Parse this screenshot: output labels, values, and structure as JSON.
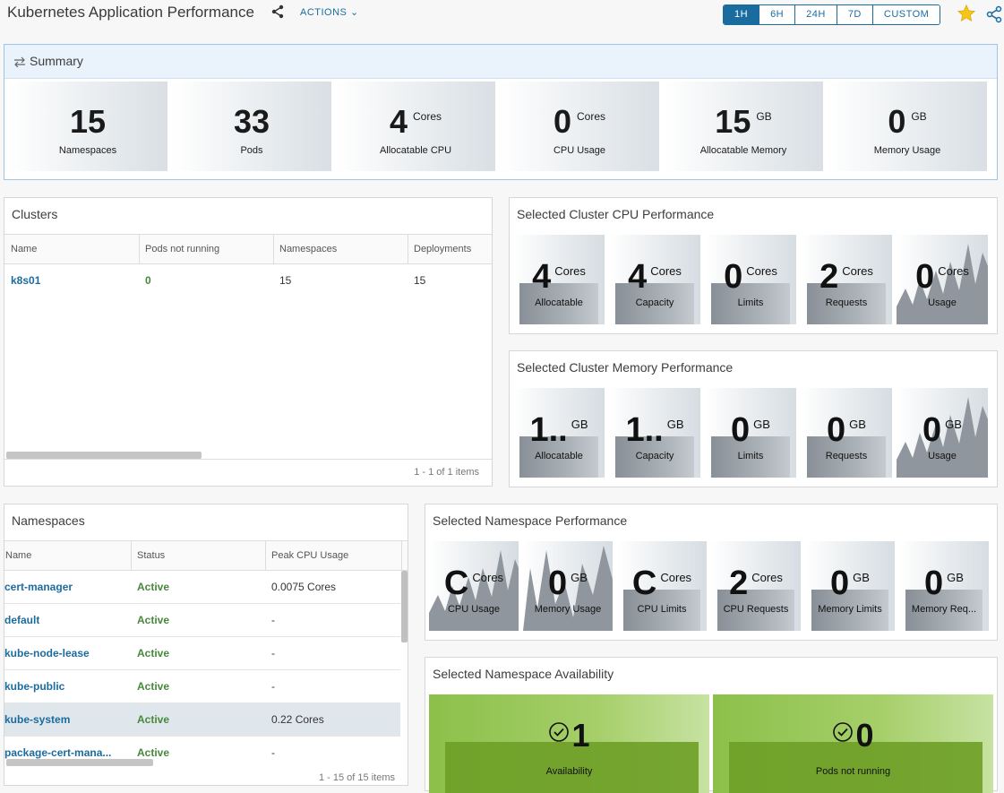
{
  "header": {
    "title": "Kubernetes Application Performance",
    "actions_label": "ACTIONS",
    "time_ranges": [
      "1H",
      "6H",
      "24H",
      "7D",
      "CUSTOM"
    ],
    "active_range": "1H"
  },
  "summary": {
    "title": "Summary",
    "tiles": [
      {
        "value": "15",
        "unit": "",
        "label": "Namespaces"
      },
      {
        "value": "33",
        "unit": "",
        "label": "Pods"
      },
      {
        "value": "4",
        "unit": "Cores",
        "label": "Allocatable CPU"
      },
      {
        "value": "0",
        "unit": "Cores",
        "label": "CPU Usage"
      },
      {
        "value": "15",
        "unit": "GB",
        "label": "Allocatable Memory"
      },
      {
        "value": "0",
        "unit": "GB",
        "label": "Memory Usage"
      }
    ]
  },
  "clusters": {
    "title": "Clusters",
    "columns": [
      "Name",
      "Pods not running",
      "Namespaces",
      "Deployments"
    ],
    "rows": [
      {
        "name": "k8s01",
        "pods_not_running": "0",
        "namespaces": "15",
        "deployments": "15"
      }
    ],
    "footer": "1 - 1 of 1 items"
  },
  "cluster_cpu": {
    "title": "Selected Cluster CPU Performance",
    "tiles": [
      {
        "value": "4",
        "unit": "Cores",
        "label": "Allocatable",
        "fill": 0.46
      },
      {
        "value": "4",
        "unit": "Cores",
        "label": "Capacity",
        "fill": 0.46
      },
      {
        "value": "0",
        "unit": "Cores",
        "label": "Limits",
        "fill": 0.46
      },
      {
        "value": "2",
        "unit": "Cores",
        "label": "Requests",
        "fill": 0.46
      },
      {
        "value": "0",
        "unit": "Cores",
        "label": "Usage",
        "fill": 0
      }
    ]
  },
  "cluster_mem": {
    "title": "Selected Cluster Memory Performance",
    "tiles": [
      {
        "value": "1..",
        "unit": "GB",
        "label": "Allocatable",
        "fill": 0.46
      },
      {
        "value": "1..",
        "unit": "GB",
        "label": "Capacity",
        "fill": 0.46
      },
      {
        "value": "0",
        "unit": "GB",
        "label": "Limits",
        "fill": 0.46
      },
      {
        "value": "0",
        "unit": "GB",
        "label": "Requests",
        "fill": 0.46
      },
      {
        "value": "0",
        "unit": "GB",
        "label": "Usage",
        "fill": 0
      }
    ]
  },
  "namespaces": {
    "title": "Namespaces",
    "columns": [
      "Name",
      "Status",
      "Peak CPU Usage"
    ],
    "rows": [
      {
        "name": "cert-manager",
        "status": "Active",
        "peak_cpu": "0.0075 Cores"
      },
      {
        "name": "default",
        "status": "Active",
        "peak_cpu": "-"
      },
      {
        "name": "kube-node-lease",
        "status": "Active",
        "peak_cpu": "-"
      },
      {
        "name": "kube-public",
        "status": "Active",
        "peak_cpu": "-"
      },
      {
        "name": "kube-system",
        "status": "Active",
        "peak_cpu": "0.22 Cores"
      },
      {
        "name": "package-cert-mana...",
        "status": "Active",
        "peak_cpu": "-"
      }
    ],
    "footer": "1 - 15 of 15 items"
  },
  "ns_perf": {
    "title": "Selected Namespace Performance",
    "tiles": [
      {
        "value": "C",
        "unit": "Cores",
        "label": "CPU Usage",
        "fill": 0
      },
      {
        "value": "0",
        "unit": "GB",
        "label": "Memory Usage",
        "fill": 0
      },
      {
        "value": "C",
        "unit": "Cores",
        "label": "CPU Limits",
        "fill": 0.46
      },
      {
        "value": "2",
        "unit": "Cores",
        "label": "CPU Requests",
        "fill": 0.46
      },
      {
        "value": "0",
        "unit": "GB",
        "label": "Memory Limits",
        "fill": 0.46
      },
      {
        "value": "0",
        "unit": "GB",
        "label": "Memory Req...",
        "fill": 0.46
      }
    ]
  },
  "ns_avail": {
    "title": "Selected Namespace Availability",
    "tiles": [
      {
        "value": "1",
        "label": "Availability"
      },
      {
        "value": "0",
        "label": "Pods not running"
      }
    ]
  },
  "colors": {
    "accent": "#1b6c9e",
    "active_green": "#48883b",
    "avail_green": "#8cc04a",
    "star": "#f5c518"
  }
}
